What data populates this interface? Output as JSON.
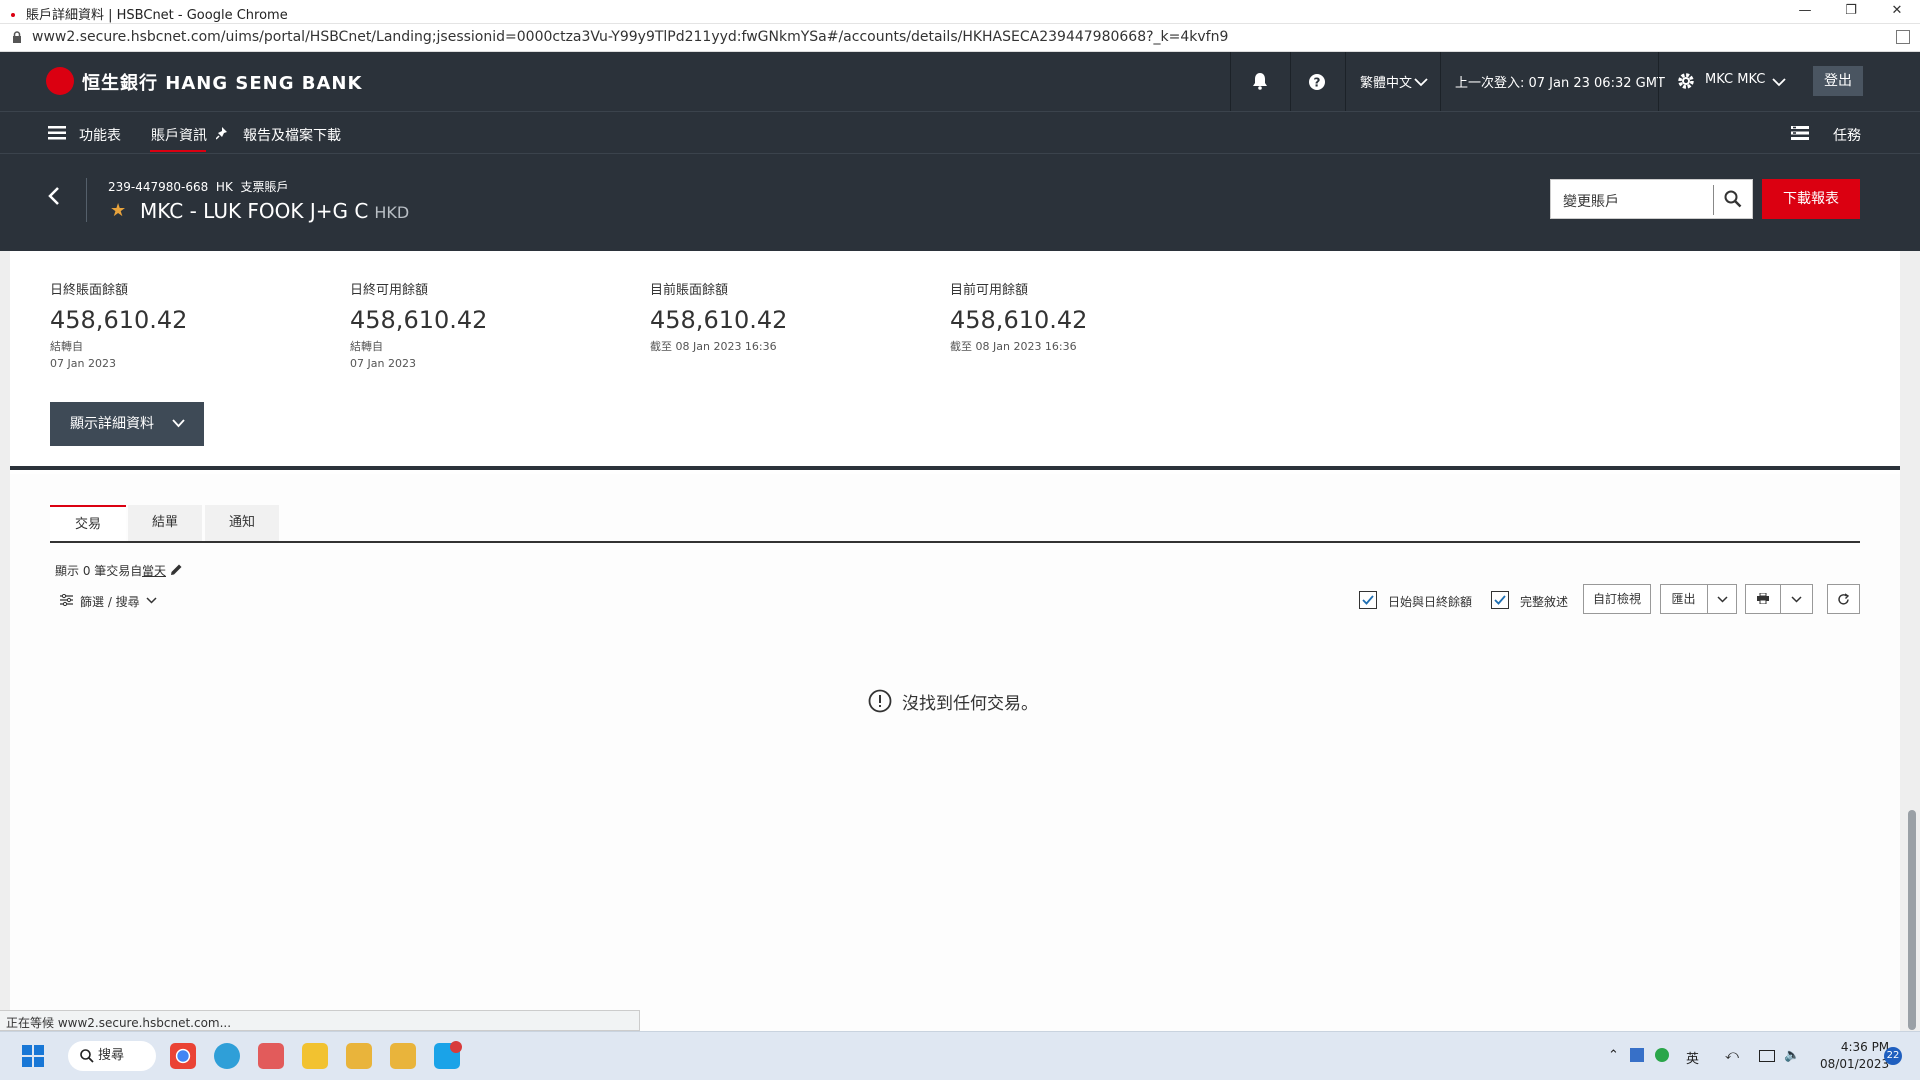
{
  "browser": {
    "tab_title": "賬戶詳細資料 | HSBCnet - Google Chrome",
    "url": "www2.secure.hsbcnet.com/uims/portal/HSBCnet/Landing;jsessionid=0000ctza3Vu-Y99y9TlPd211yyd:fwGNkmYSa#/accounts/details/HKHASECA239447980668?_k=4kvfn9",
    "status": "正在等候 www2.secure.hsbcnet.com..."
  },
  "topnav": {
    "brand": "恒生銀行 HANG SENG BANK",
    "language": "繁體中文",
    "last_login": "上一次登入: 07 Jan 23 06:32 GMT",
    "user": "MKC MKC",
    "logout": "登出",
    "icons": [
      "bell-icon",
      "help-icon",
      "chevron-down-icon",
      "gear-icon"
    ]
  },
  "subnav": {
    "menu": "功能表",
    "account_info": "賬戶資訊",
    "reports": "報告及檔案下載",
    "tasks": "任務"
  },
  "account": {
    "number": "239-447980-668",
    "region": "HK",
    "type": "支票賬戶",
    "name": "MKC - LUK FOOK J+G C",
    "currency": "HKD",
    "change_placeholder": "變更賬戶",
    "download": "下載報表"
  },
  "balances": [
    {
      "label": "日終賬面餘額",
      "value": "458,610.42",
      "note": "結轉自",
      "date": "07 Jan 2023"
    },
    {
      "label": "日終可用餘額",
      "value": "458,610.42",
      "note": "結轉自",
      "date": "07 Jan 2023"
    },
    {
      "label": "目前賬面餘額",
      "value": "458,610.42",
      "note": "截至 08 Jan 2023 16:36",
      "date": ""
    },
    {
      "label": "目前可用餘額",
      "value": "458,610.42",
      "note": "截至 08 Jan 2023 16:36",
      "date": ""
    }
  ],
  "show_details": "顯示詳細資料",
  "tabs": [
    "交易",
    "結單",
    "通知"
  ],
  "transactions": {
    "showing_prefix": "顯示 0 筆交易自",
    "showing_link": "當天",
    "filter": "篩選 / 搜尋",
    "chk_opening": "日始與日終餘額",
    "chk_full": "完整敘述",
    "custom_view": "自訂檢視",
    "export": "匯出",
    "empty_msg": "沒找到任何交易。"
  },
  "taskbar": {
    "search": "搜尋",
    "ime": "英",
    "time": "4:36 PM",
    "date": "08/01/2023",
    "notifications": "22"
  }
}
